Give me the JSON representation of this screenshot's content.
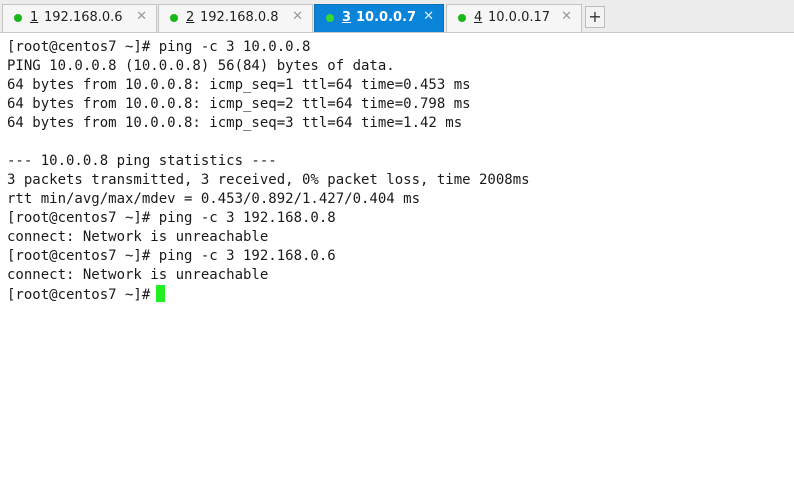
{
  "tabs": [
    {
      "number": "1",
      "label": "192.168.0.6",
      "status": "connected",
      "active": false
    },
    {
      "number": "2",
      "label": "192.168.0.8",
      "status": "connected",
      "active": false
    },
    {
      "number": "3",
      "label": "10.0.0.7",
      "status": "connected",
      "active": true
    },
    {
      "number": "4",
      "label": "10.0.0.17",
      "status": "connected",
      "active": false
    }
  ],
  "tab_close_glyph": "✕",
  "new_tab_glyph": "+",
  "colors": {
    "active_tab": "#0a84d8",
    "status_dot": "#19b519",
    "cursor": "#22ee22"
  },
  "terminal": {
    "lines": [
      "[root@centos7 ~]# ping -c 3 10.0.0.8",
      "PING 10.0.0.8 (10.0.0.8) 56(84) bytes of data.",
      "64 bytes from 10.0.0.8: icmp_seq=1 ttl=64 time=0.453 ms",
      "64 bytes from 10.0.0.8: icmp_seq=2 ttl=64 time=0.798 ms",
      "64 bytes from 10.0.0.8: icmp_seq=3 ttl=64 time=1.42 ms",
      "",
      "--- 10.0.0.8 ping statistics ---",
      "3 packets transmitted, 3 received, 0% packet loss, time 2008ms",
      "rtt min/avg/max/mdev = 0.453/0.892/1.427/0.404 ms",
      "[root@centos7 ~]# ping -c 3 192.168.0.8",
      "connect: Network is unreachable",
      "[root@centos7 ~]# ping -c 3 192.168.0.6",
      "connect: Network is unreachable"
    ],
    "prompt": "[root@centos7 ~]#"
  }
}
